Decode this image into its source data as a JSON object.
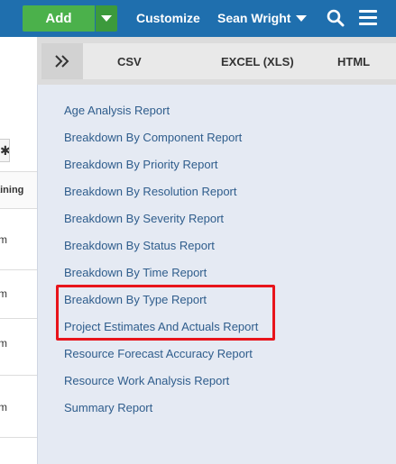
{
  "topbar": {
    "add_label": "Add",
    "customize_label": "Customize",
    "user_label": "Sean Wright",
    "colors": {
      "bar": "#1f6fae",
      "add": "#4bb14b"
    }
  },
  "left_table": {
    "header_fragment": "aining",
    "cell_fragment": "m"
  },
  "export_tabs": {
    "csv": "CSV",
    "excel": "EXCEL (XLS)",
    "html": "HTML"
  },
  "reports": [
    "Age Analysis Report",
    "Breakdown By Component Report",
    "Breakdown By Priority Report",
    "Breakdown By Resolution Report",
    "Breakdown By Severity Report",
    "Breakdown By Status Report",
    "Breakdown By Time Report",
    "Breakdown By Type Report",
    "Project Estimates And Actuals Report",
    "Resource Forecast Accuracy Report",
    "Resource Work Analysis Report",
    "Summary Report"
  ],
  "highlight_color": "#e8141b"
}
